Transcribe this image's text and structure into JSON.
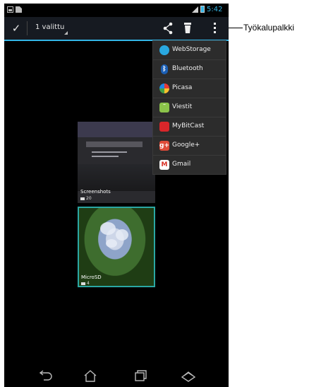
{
  "status_bar": {
    "time": "5:42"
  },
  "action_bar": {
    "selection_count": "1 valittu"
  },
  "share_menu": {
    "items": [
      {
        "label": "WebStorage",
        "icon": "webstorage-icon",
        "color": "#29a8e0"
      },
      {
        "label": "Bluetooth",
        "icon": "bluetooth-icon",
        "color": "#1b5fb5"
      },
      {
        "label": "Picasa",
        "icon": "picasa-icon",
        "color": "#e8e8e8"
      },
      {
        "label": "Viestit",
        "icon": "messaging-icon",
        "color": "#8bc34a"
      },
      {
        "label": "MyBitCast",
        "icon": "mybitcast-icon",
        "color": "#d9262a"
      },
      {
        "label": "Google+",
        "icon": "google-plus-icon",
        "color": "#dd4b39"
      },
      {
        "label": "Gmail",
        "icon": "gmail-icon",
        "color": "#ffffff"
      }
    ]
  },
  "gallery": {
    "albums": [
      {
        "name": "Screenshots",
        "count": "20"
      },
      {
        "name": "MicroSD",
        "count": "4"
      }
    ]
  },
  "annotation": {
    "label": "Työkalupalkki"
  },
  "colors": {
    "accent": "#33b5e5",
    "selection_border": "#2aa7a3",
    "action_bar_bg": "#161a21"
  }
}
